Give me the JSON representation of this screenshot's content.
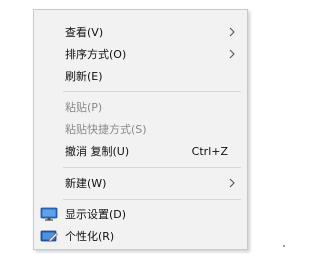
{
  "context_menu": {
    "items": [
      {
        "label": "查看(V)",
        "has_submenu": true,
        "icon": "chevron-right-icon"
      },
      {
        "label": "排序方式(O)",
        "has_submenu": true,
        "icon": "chevron-right-icon"
      },
      {
        "label": "刷新(E)"
      },
      {
        "label": "粘贴(P)",
        "disabled": true
      },
      {
        "label": "粘贴快捷方式(S)",
        "disabled": true
      },
      {
        "label": "撤消 复制(U)",
        "shortcut": "Ctrl+Z"
      },
      {
        "label": "新建(W)",
        "has_submenu": true,
        "icon": "chevron-right-icon"
      },
      {
        "label": "显示设置(D)",
        "icon": "monitor-icon"
      },
      {
        "label": "个性化(R)",
        "icon": "personalize-icon"
      }
    ]
  },
  "colors": {
    "menu_background": "#f2f2f2",
    "disabled_text": "#8a8a8a",
    "separator": "#d6d6d6"
  }
}
